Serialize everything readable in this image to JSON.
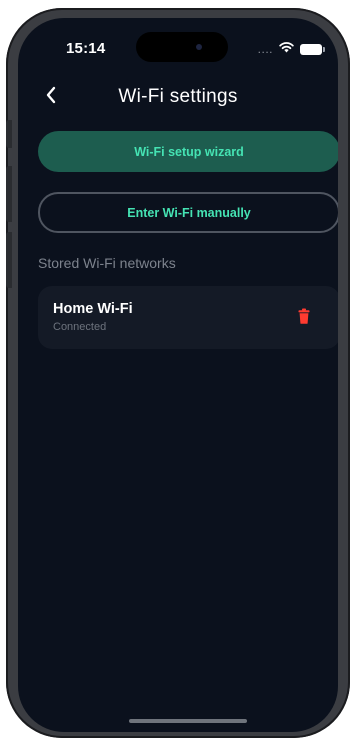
{
  "status_bar": {
    "time": "15:14",
    "signal": "....",
    "icons": [
      "wifi-icon",
      "battery-icon"
    ]
  },
  "nav": {
    "title": "Wi-Fi settings",
    "back_icon": "chevron-left-icon"
  },
  "buttons": {
    "wizard_label": "Wi-Fi setup wizard",
    "manual_label": "Enter Wi-Fi manually"
  },
  "stored_networks": {
    "section_label": "Stored Wi-Fi networks",
    "items": [
      {
        "name": "Home Wi-Fi",
        "status": "Connected",
        "action_icon": "trash-icon"
      }
    ]
  },
  "colors": {
    "background": "#0b111d",
    "card": "#141a26",
    "accent": "#45e3b3",
    "primary_button": "#1d5d4f",
    "delete": "#ff3b30"
  }
}
